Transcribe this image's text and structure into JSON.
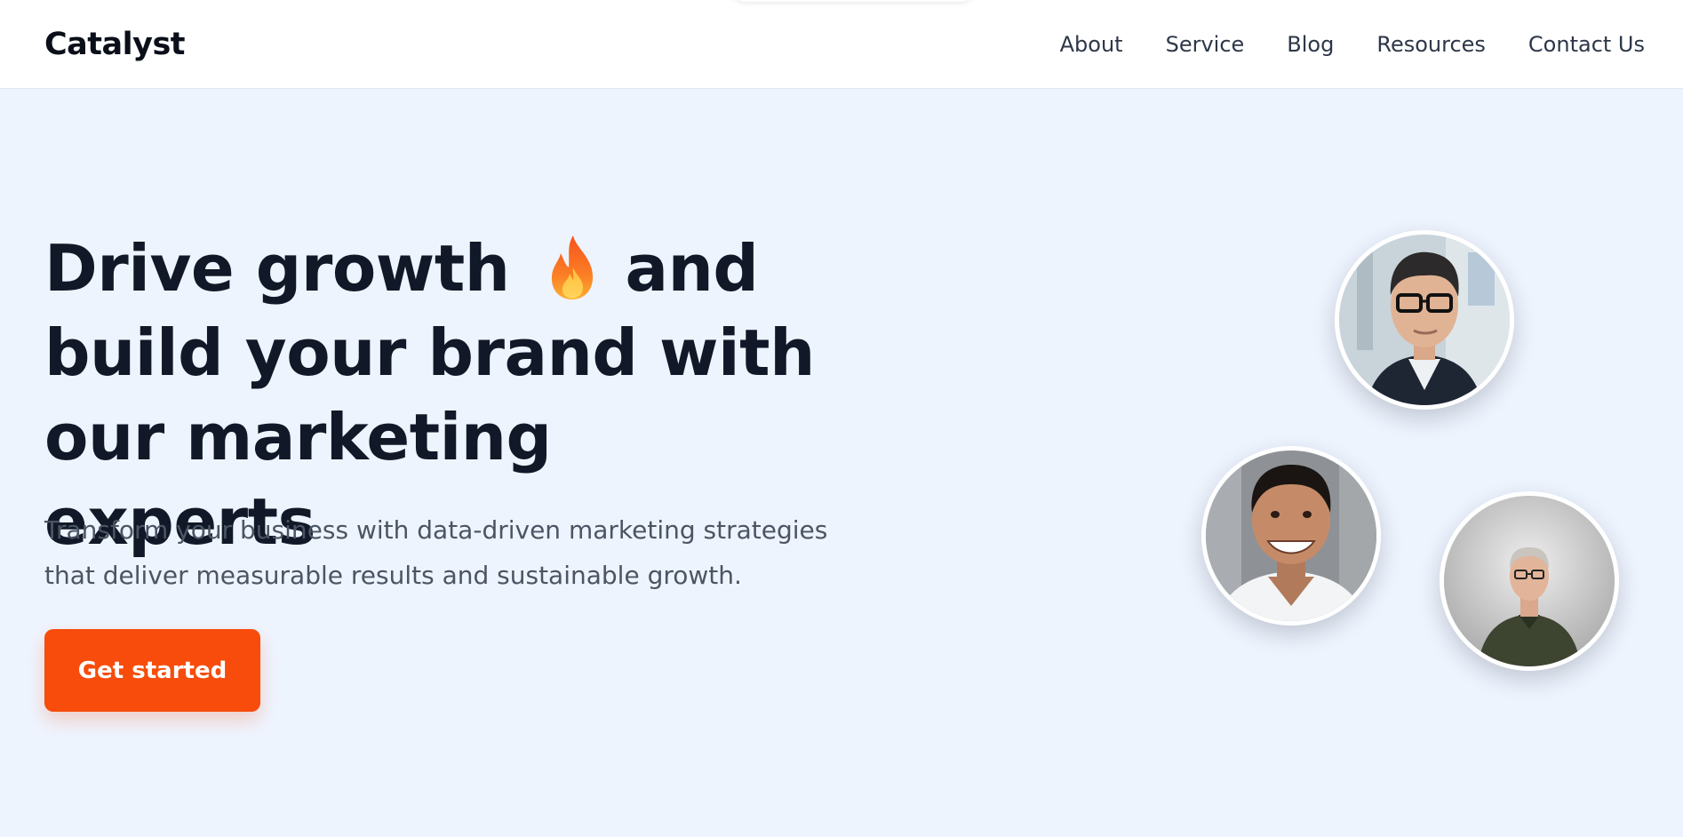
{
  "header": {
    "logo": "Catalyst",
    "nav": [
      "About",
      "Service",
      "Blog",
      "Resources",
      "Contact Us"
    ]
  },
  "hero": {
    "title_line1_start": "Drive growth",
    "title_line1_end": "and",
    "title_line2": "build your brand with",
    "title_line3": "our marketing experts",
    "title_icon": "fire-icon",
    "subtitle_line1": "Transform your business with data-driven marketing strategies",
    "subtitle_line2": "that deliver measurable results and sustainable growth.",
    "cta_label": "Get started"
  },
  "avatars": [
    "avatar-man-glasses",
    "avatar-man-smiling",
    "avatar-older-man"
  ],
  "colors": {
    "accent": "#f74c0c",
    "hero_background": "#eef4fe",
    "heading": "#111827",
    "body_text": "#4b5563"
  }
}
